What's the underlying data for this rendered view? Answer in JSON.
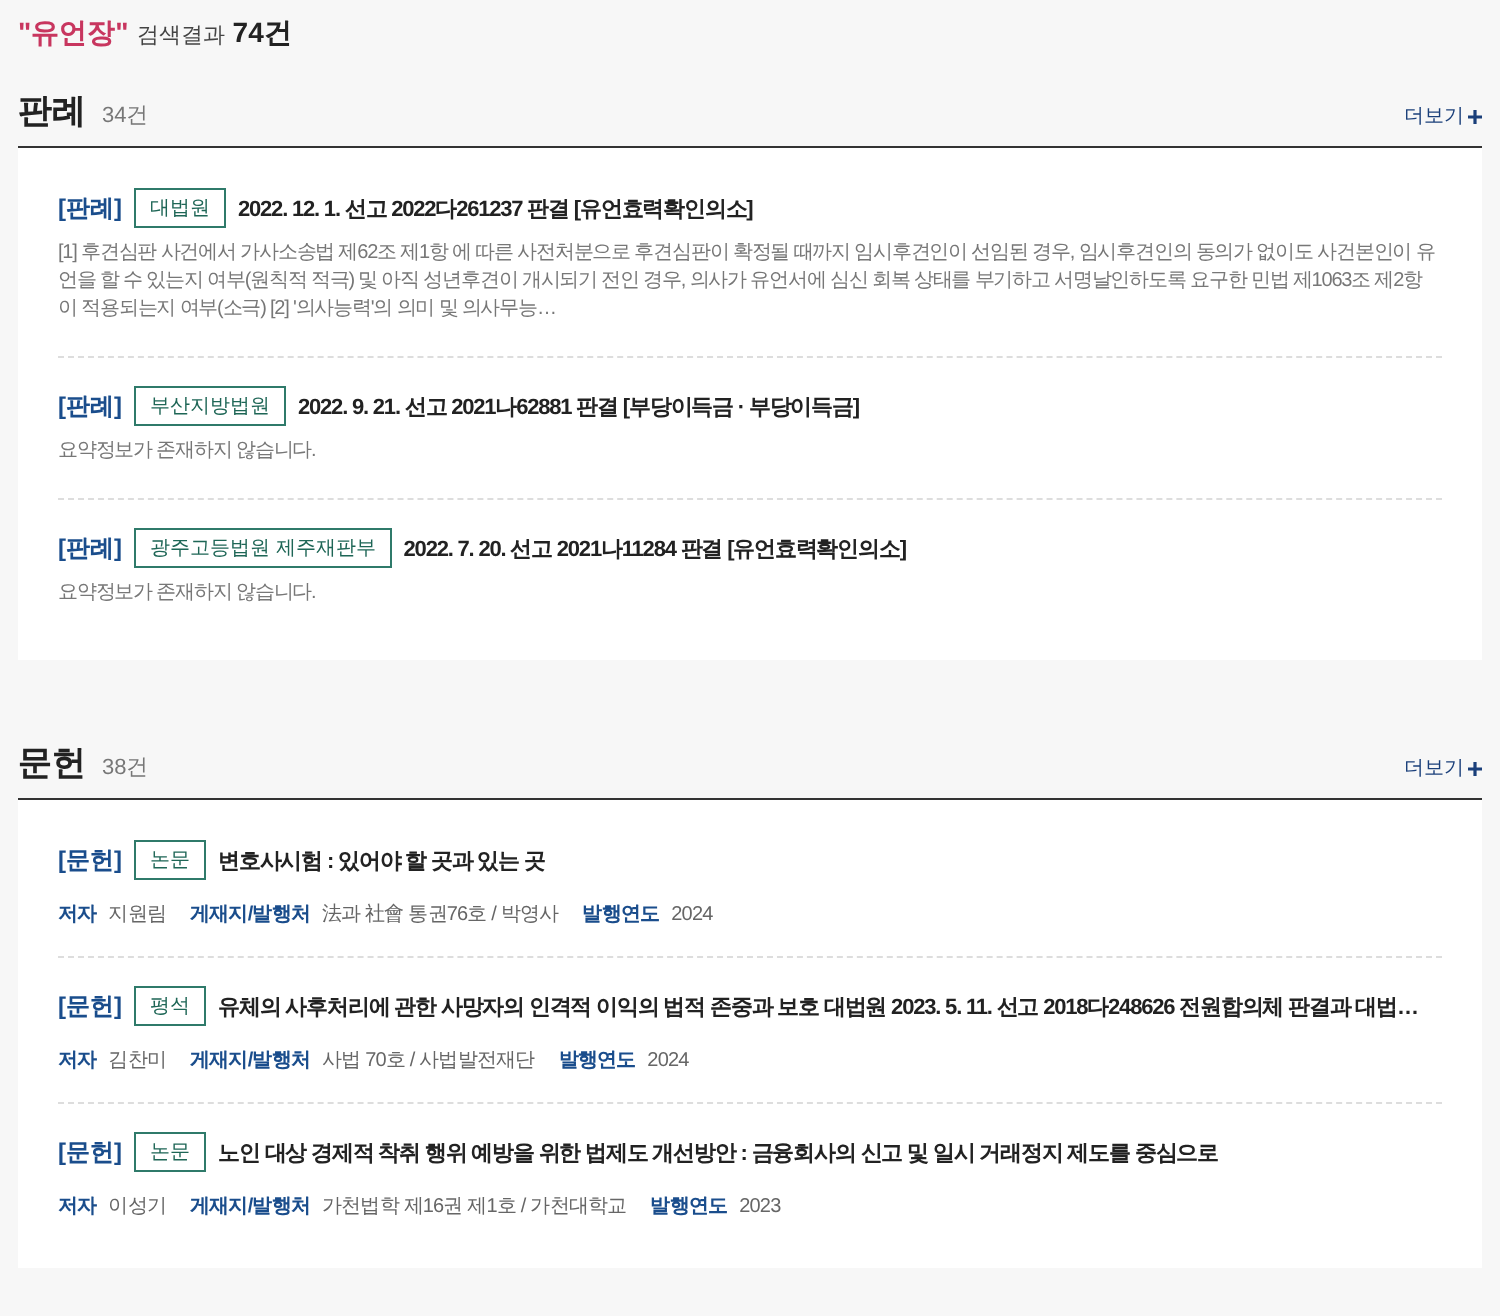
{
  "header": {
    "query": "\"유언장\"",
    "label": "검색결과",
    "count": "74건"
  },
  "sections": [
    {
      "title": "판례",
      "count": "34건",
      "more": "더보기",
      "items": [
        {
          "kind": "case",
          "category": "[판례]",
          "court": "대법원",
          "title": "2022. 12. 1. 선고 2022다261237 판결 [유언효력확인의소]",
          "summary": "[1] 후견심판 사건에서 가사소송법 제62조 제1항 에 따른 사전처분으로 후견심판이 확정될 때까지 임시후견인이 선임된 경우, 임시후견인의 동의가 없이도 사건본인이 유언을 할 수 있는지 여부(원칙적 적극) 및 아직 성년후견이 개시되기 전인 경우, 의사가 유언서에 심신 회복 상태를 부기하고 서명날인하도록 요구한 민법 제1063조 제2항 이 적용되는지 여부(소극) [2] '의사능력'의 의미 및 의사무능…"
        },
        {
          "kind": "case",
          "category": "[판례]",
          "court": "부산지방법원",
          "title": "2022. 9. 21. 선고 2021나62881 판결 [부당이득금 · 부당이득금]",
          "summary": "요약정보가 존재하지 않습니다."
        },
        {
          "kind": "case",
          "category": "[판례]",
          "court": "광주고등법원 제주재판부",
          "title": "2022. 7. 20. 선고 2021나11284 판결 [유언효력확인의소]",
          "summary": "요약정보가 존재하지 않습니다."
        }
      ]
    },
    {
      "title": "문헌",
      "count": "38건",
      "more": "더보기",
      "items": [
        {
          "kind": "doc",
          "category": "[문헌]",
          "court": "논문",
          "title": "변호사시험 : 있어야 할 곳과 있는 곳",
          "meta": [
            {
              "label": "저자",
              "value": "지원림"
            },
            {
              "label": "게재지/발행처",
              "value": "法과 社會 통권76호 / 박영사"
            },
            {
              "label": "발행연도",
              "value": "2024"
            }
          ]
        },
        {
          "kind": "doc",
          "category": "[문헌]",
          "court": "평석",
          "title": "유체의 사후처리에 관한 사망자의 인격적 이익의 법적 존중과 보호 대법원 2023. 5. 11. 선고 2018다248626 전원합의체 판결과 대법…",
          "meta": [
            {
              "label": "저자",
              "value": "김찬미"
            },
            {
              "label": "게재지/발행처",
              "value": "사법 70호 / 사법발전재단"
            },
            {
              "label": "발행연도",
              "value": "2024"
            }
          ]
        },
        {
          "kind": "doc",
          "category": "[문헌]",
          "court": "논문",
          "title": "노인 대상 경제적 착취 행위 예방을 위한 법제도 개선방안 : 금융회사의 신고 및 일시 거래정지 제도를 중심으로",
          "meta": [
            {
              "label": "저자",
              "value": "이성기"
            },
            {
              "label": "게재지/발행처",
              "value": "가천법학 제16권 제1호 / 가천대학교"
            },
            {
              "label": "발행연도",
              "value": "2023"
            }
          ]
        }
      ]
    }
  ]
}
